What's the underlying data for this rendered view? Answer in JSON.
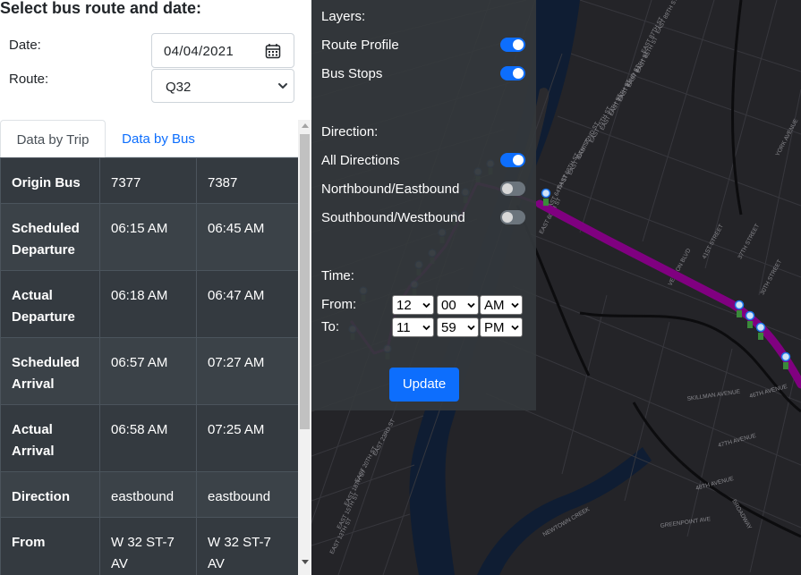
{
  "form": {
    "title": "Select bus route and date:",
    "date_label": "Date:",
    "date_value": "04/04/2021",
    "route_label": "Route:",
    "route_value": "Q32"
  },
  "tabs": [
    {
      "label": "Data by Trip",
      "active": true
    },
    {
      "label": "Data by Bus",
      "active": false
    }
  ],
  "table": {
    "rows": [
      {
        "label": "Origin Bus",
        "values": [
          "7377",
          "7387"
        ]
      },
      {
        "label": "Scheduled Departure",
        "values": [
          "06:15 AM",
          "06:45 AM"
        ]
      },
      {
        "label": "Actual Departure",
        "values": [
          "06:18 AM",
          "06:47 AM"
        ]
      },
      {
        "label": "Scheduled Arrival",
        "values": [
          "06:57 AM",
          "07:27 AM"
        ]
      },
      {
        "label": "Actual Arrival",
        "values": [
          "06:58 AM",
          "07:25 AM"
        ]
      },
      {
        "label": "Direction",
        "values": [
          "eastbound",
          "eastbound"
        ]
      },
      {
        "label": "From",
        "values": [
          "W 32 ST-7 AV",
          "W 32 ST-7 AV"
        ]
      }
    ]
  },
  "controls": {
    "layers_label": "Layers:",
    "route_profile": {
      "label": "Route Profile",
      "on": true
    },
    "bus_stops": {
      "label": "Bus Stops",
      "on": true
    },
    "direction_label": "Direction:",
    "all_directions": {
      "label": "All Directions",
      "on": true
    },
    "northbound": {
      "label": "Northbound/Eastbound",
      "on": false
    },
    "southbound": {
      "label": "Southbound/Westbound",
      "on": false
    },
    "time_label": "Time:",
    "from_label": "From:",
    "to_label": "To:",
    "from_hour": "12",
    "from_minute": "00",
    "from_ampm": "AM",
    "to_hour": "11",
    "to_minute": "59",
    "to_ampm": "PM",
    "colon": ":",
    "update_label": "Update"
  },
  "map": {
    "street_labels": [
      "EAST 89TH ST",
      "EAST 87TH ST",
      "EAST 85TH ST",
      "EAST 84TH ST",
      "EAST 82ND ST",
      "EAST 79TH ST",
      "EAST 77TH ST",
      "EAST 75TH ST",
      "EAST 72ND ST",
      "EAST 70TH ST",
      "EAST 68TH ST",
      "EAST 64TH ST",
      "EAST 60TH ST",
      "EAST 23RD ST",
      "EAST 20TH ST",
      "EAST 18TH ST",
      "EAST 15TH ST",
      "EAST 13TH ST",
      "37TH STREET",
      "46TH AVENUE",
      "47TH AVENUE",
      "48TH AVENUE",
      "SKILLMAN AVENUE",
      "GREENPOINT AVE",
      "VERNON BLVD",
      "NEWTOWN CREEK",
      "BROADWAY",
      "41ST STREET",
      "30TH STREET",
      "YORK AVENUE"
    ],
    "route_color": "#800080",
    "stop_icon_color": "#1a73e8"
  },
  "colors": {
    "accent": "#0d6efd",
    "table_bg": "#343a40",
    "panel_bg": "#34383c",
    "map_bg": "#242428"
  }
}
